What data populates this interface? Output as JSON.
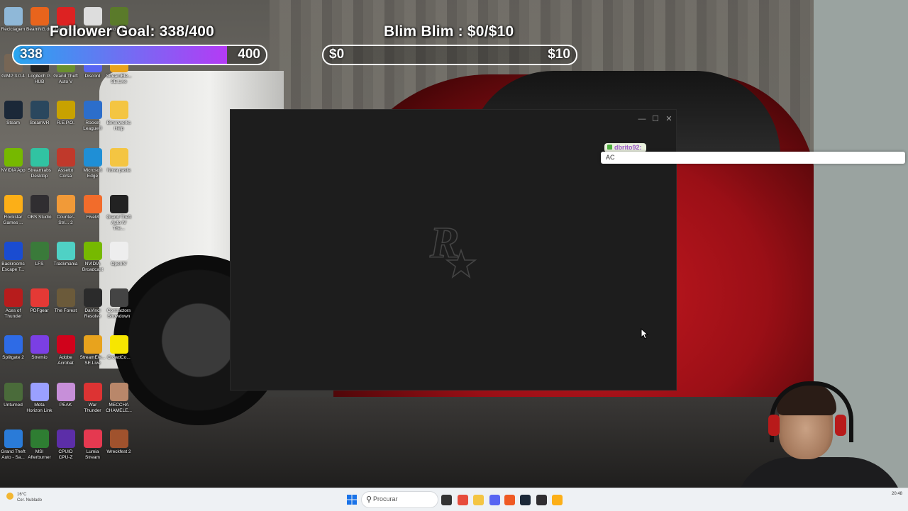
{
  "overlay": {
    "follower_goal": {
      "title": "Follower Goal: 338/400",
      "current_label": "338",
      "target_label": "400",
      "progress": 0.845
    },
    "donation_goal": {
      "title": "Blim Blim : $0/$10",
      "current_label": "$0",
      "target_label": "$10",
      "progress": 0.0
    },
    "colors": {
      "follower_fill_start": "#27a6f0",
      "follower_fill_end": "#b43bf5"
    }
  },
  "desktop": {
    "icons": [
      {
        "label": "Reciclagem",
        "icon": "recycle-bin-icon",
        "color": "#8fb8d8"
      },
      {
        "label": "BeamNG.dr...",
        "icon": "beamng-icon",
        "color": "#e8641c"
      },
      {
        "label": "Manager.exe",
        "icon": "manager-icon",
        "color": "#d22"
      },
      {
        "label": "",
        "icon": "counter-strike-icon",
        "color": "#ddd"
      },
      {
        "label": "Auto V En...",
        "icon": "gta-v-icon",
        "color": "#5a7a2a"
      },
      {
        "label": "GIMP 3.0.4",
        "icon": "gimp-icon",
        "color": "#776655"
      },
      {
        "label": "Logitech G HUB",
        "icon": "logitech-icon",
        "color": "#222"
      },
      {
        "label": "Grand Theft Auto V",
        "icon": "gta-v-icon",
        "color": "#6a8f2e"
      },
      {
        "label": "Discord",
        "icon": "discord-icon",
        "color": "#5865f2"
      },
      {
        "label": "StreamEle... SE.Live",
        "icon": "streamelements-icon",
        "color": "#e8a31d"
      },
      {
        "label": "Steam",
        "icon": "steam-icon",
        "color": "#1b2838"
      },
      {
        "label": "SteamVR",
        "icon": "steamvr-icon",
        "color": "#2a475e"
      },
      {
        "label": "R.E.P.O.",
        "icon": "repo-icon",
        "color": "#c8a200"
      },
      {
        "label": "Rocket League®",
        "icon": "rocket-league-icon",
        "color": "#2c6ecb"
      },
      {
        "label": "Bimmworks Help",
        "icon": "folder-icon",
        "color": "#f4c542"
      },
      {
        "label": "NVIDIA App",
        "icon": "nvidia-icon",
        "color": "#76b900"
      },
      {
        "label": "Streamlabs Desktop",
        "icon": "streamlabs-icon",
        "color": "#31c3a2"
      },
      {
        "label": "Assetto Corsa",
        "icon": "assetto-corsa-icon",
        "color": "#c0392b"
      },
      {
        "label": "Microsoft Edge",
        "icon": "edge-icon",
        "color": "#1f8fd6"
      },
      {
        "label": "Nova pasta",
        "icon": "folder-icon",
        "color": "#f4c542"
      },
      {
        "label": "Rockstar Games ...",
        "icon": "rockstar-icon",
        "color": "#fcaf17"
      },
      {
        "label": "OBS Studio",
        "icon": "obs-icon",
        "color": "#302e31"
      },
      {
        "label": "Counter-Stri... 2",
        "icon": "counter-strike-icon",
        "color": "#f19a38"
      },
      {
        "label": "FiveM",
        "icon": "fivem-icon",
        "color": "#f26c2b"
      },
      {
        "label": "Grand Theft Auto IV The...",
        "icon": "gta-iv-icon",
        "color": "#222"
      },
      {
        "label": "Backrooms Escape T...",
        "icon": "backrooms-icon",
        "color": "#1a4cd1"
      },
      {
        "label": "LFS",
        "icon": "lfs-icon",
        "color": "#3a7a3a"
      },
      {
        "label": "Trackmania",
        "icon": "trackmania-icon",
        "color": "#4fd1c5"
      },
      {
        "label": "NVIDIA Broadcast",
        "icon": "nvidia-broadcast-icon",
        "color": "#76b900"
      },
      {
        "label": "OpenIV",
        "icon": "openiv-icon",
        "color": "#eeeeee"
      },
      {
        "label": "Aces of Thunder",
        "icon": "aces-icon",
        "color": "#b71c1c"
      },
      {
        "label": "PDFgear",
        "icon": "pdf-icon",
        "color": "#e53935"
      },
      {
        "label": "The Forest",
        "icon": "the-forest-icon",
        "color": "#6b5a3a"
      },
      {
        "label": "DaVinci Resolve",
        "icon": "davinci-icon",
        "color": "#2b2b2b"
      },
      {
        "label": "Contractors Showdown",
        "icon": "contractors-icon",
        "color": "#444"
      },
      {
        "label": "Splitgate 2",
        "icon": "splitgate-icon",
        "color": "#2e6be6"
      },
      {
        "label": "Stremio",
        "icon": "stremio-icon",
        "color": "#7b3fe4"
      },
      {
        "label": "Adobe Acrobat",
        "icon": "acrobat-icon",
        "color": "#d0021b"
      },
      {
        "label": "StreamEle... SE.Live",
        "icon": "streamelements-icon",
        "color": "#e8a31d"
      },
      {
        "label": "CrowdCo...",
        "icon": "crowdcontrol-icon",
        "color": "#f7e600"
      },
      {
        "label": "Unturned",
        "icon": "unturned-icon",
        "color": "#4a6b3a"
      },
      {
        "label": "Meta Horizon Link",
        "icon": "meta-icon",
        "color": "#9aa0ff"
      },
      {
        "label": "PEAK",
        "icon": "peak-icon",
        "color": "#c78fd9"
      },
      {
        "label": "War Thunder",
        "icon": "war-thunder-icon",
        "color": "#d33"
      },
      {
        "label": "MECCHA CHAMELE...",
        "icon": "meccha-icon",
        "color": "#b9876a"
      },
      {
        "label": "Grand Theft Auto - Sa...",
        "icon": "gta-sa-icon",
        "color": "#2a7bd8"
      },
      {
        "label": "MSI Afterburner",
        "icon": "msi-icon",
        "color": "#2e7d32"
      },
      {
        "label": "CPUID CPU-Z",
        "icon": "cpuz-icon",
        "color": "#5c2ea8"
      },
      {
        "label": "Lumia Stream",
        "icon": "lumia-icon",
        "color": "#e53950"
      },
      {
        "label": "Wreckfest 2",
        "icon": "wreckfest-icon",
        "color": "#a0522d"
      }
    ]
  },
  "launcher": {
    "minimize": "—",
    "maximize": "☐",
    "close": "✕",
    "logo_letter": "R"
  },
  "chat": {
    "username": "dbrito92:",
    "message": "AC"
  },
  "taskbar": {
    "weather_temp": "16°C",
    "weather_text": "Cer. Nublado",
    "search_placeholder": "Procurar",
    "clock_time": "20:48",
    "clock_date": "",
    "apps": [
      {
        "icon": "task-view-icon",
        "color": "#333"
      },
      {
        "icon": "chrome-icon",
        "color": "#e74c3c"
      },
      {
        "icon": "file-explorer-icon",
        "color": "#f4c542"
      },
      {
        "icon": "discord-icon",
        "color": "#5865f2"
      },
      {
        "icon": "brave-icon",
        "color": "#ef5a24"
      },
      {
        "icon": "steam-icon",
        "color": "#1b2838"
      },
      {
        "icon": "obs-icon",
        "color": "#302e31"
      },
      {
        "icon": "rockstar-icon",
        "color": "#fcaf17"
      }
    ]
  }
}
